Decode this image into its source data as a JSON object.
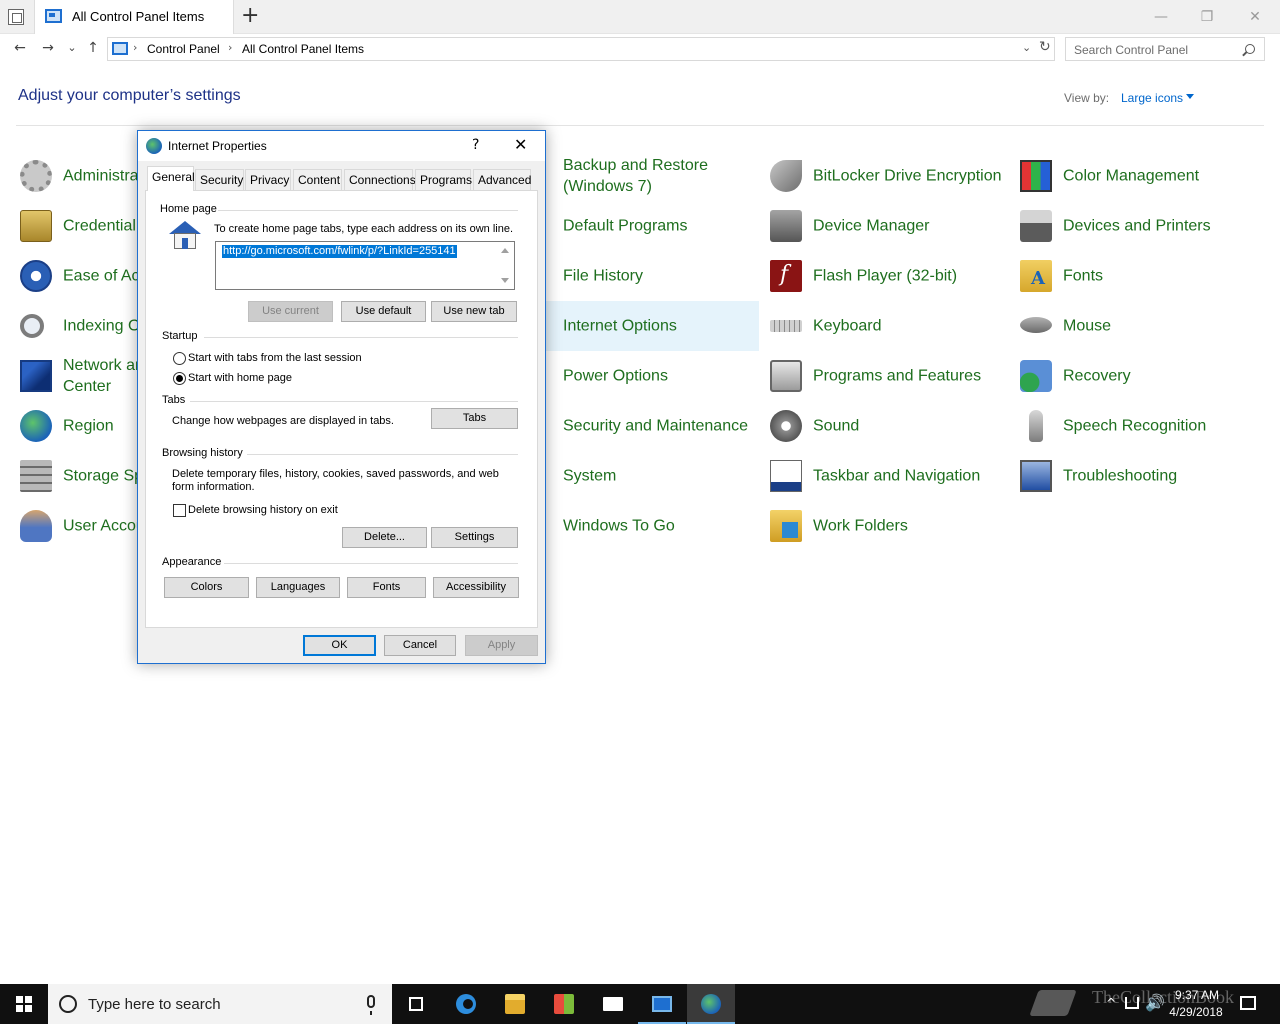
{
  "window": {
    "tab_title": "All Control Panel Items",
    "new_tab": "+",
    "minimize": "—",
    "maximize": "❐",
    "close": "✕"
  },
  "navbar": {
    "back": "←",
    "forward": "→",
    "recent": "⌄",
    "up": "↑",
    "crumb_sep": "›",
    "breadcrumbs": [
      "Control Panel",
      "All Control Panel Items"
    ],
    "dropdown": "⌄",
    "refresh": "↻",
    "search_placeholder": "Search Control Panel"
  },
  "header": {
    "title": "Adjust your computer’s settings",
    "view_by_label": "View by:",
    "view_by_value": "Large icons"
  },
  "items": [
    {
      "label": "Administra",
      "icon": "admin-tools-icon"
    },
    {
      "label": "Credential",
      "icon": "credential-manager-icon"
    },
    {
      "label": "Ease of Acc",
      "icon": "ease-of-access-icon"
    },
    {
      "label": "Indexing O",
      "icon": "indexing-options-icon"
    },
    {
      "label": "Network and Sharing Center",
      "icon": "network-icon"
    },
    {
      "label": "Region",
      "icon": "region-icon"
    },
    {
      "label": "Storage Sp",
      "icon": "storage-spaces-icon"
    },
    {
      "label": "User Accou",
      "icon": "user-accounts-icon"
    },
    {
      "label": "Backup and Restore (Windows 7)",
      "icon": "backup-icon"
    },
    {
      "label": "Default Programs",
      "icon": "default-programs-icon"
    },
    {
      "label": "File History",
      "icon": "file-history-icon"
    },
    {
      "label": "Internet Options",
      "icon": "internet-options-icon"
    },
    {
      "label": "Power Options",
      "icon": "power-options-icon"
    },
    {
      "label": "Security and Maintenance",
      "icon": "security-icon"
    },
    {
      "label": "System",
      "icon": "system-icon"
    },
    {
      "label": "Windows To Go",
      "icon": "windows-to-go-icon"
    },
    {
      "label": "BitLocker Drive Encryption",
      "icon": "bitlocker-icon"
    },
    {
      "label": "Device Manager",
      "icon": "device-manager-icon"
    },
    {
      "label": "Flash Player (32-bit)",
      "icon": "flash-player-icon"
    },
    {
      "label": "Keyboard",
      "icon": "keyboard-icon"
    },
    {
      "label": "Programs and Features",
      "icon": "programs-features-icon"
    },
    {
      "label": "Sound",
      "icon": "sound-icon"
    },
    {
      "label": "Taskbar and Navigation",
      "icon": "taskbar-navigation-icon"
    },
    {
      "label": "Work Folders",
      "icon": "work-folders-icon"
    },
    {
      "label": "Color Management",
      "icon": "color-management-icon"
    },
    {
      "label": "Devices and Printers",
      "icon": "devices-printers-icon"
    },
    {
      "label": "Fonts",
      "icon": "fonts-icon"
    },
    {
      "label": "Mouse",
      "icon": "mouse-icon"
    },
    {
      "label": "Recovery",
      "icon": "recovery-icon"
    },
    {
      "label": "Speech Recognition",
      "icon": "speech-recognition-icon"
    },
    {
      "label": "Troubleshooting",
      "icon": "troubleshooting-icon"
    }
  ],
  "dialog": {
    "title": "Internet Properties",
    "help": "?",
    "close": "✕",
    "tabs": [
      "General",
      "Security",
      "Privacy",
      "Content",
      "Connections",
      "Programs",
      "Advanced"
    ],
    "home_page": {
      "group": "Home page",
      "instruction": "To create home page tabs, type each address on its own line.",
      "url": "http://go.microsoft.com/fwlink/p/?LinkId=255141",
      "use_current": "Use current",
      "use_default": "Use default",
      "use_new_tab": "Use new tab"
    },
    "startup": {
      "group": "Startup",
      "option_last_session": "Start with tabs from the last session",
      "option_home_page": "Start with home page"
    },
    "tabs_group": {
      "group": "Tabs",
      "description": "Change how webpages are displayed in tabs.",
      "button": "Tabs"
    },
    "browsing_history": {
      "group": "Browsing history",
      "description": "Delete temporary files, history, cookies, saved passwords, and web form information.",
      "checkbox": "Delete browsing history on exit",
      "delete": "Delete...",
      "settings": "Settings"
    },
    "appearance": {
      "group": "Appearance",
      "colors": "Colors",
      "languages": "Languages",
      "fonts": "Fonts",
      "accessibility": "Accessibility"
    },
    "ok": "OK",
    "cancel": "Cancel",
    "apply": "Apply"
  },
  "taskbar": {
    "search_placeholder": "Type here to search",
    "tray_expand": "^",
    "tray_volume": "🔊",
    "time": "9:37 AM",
    "date": "4/29/2018",
    "watermark": "TheCollectionBook"
  }
}
